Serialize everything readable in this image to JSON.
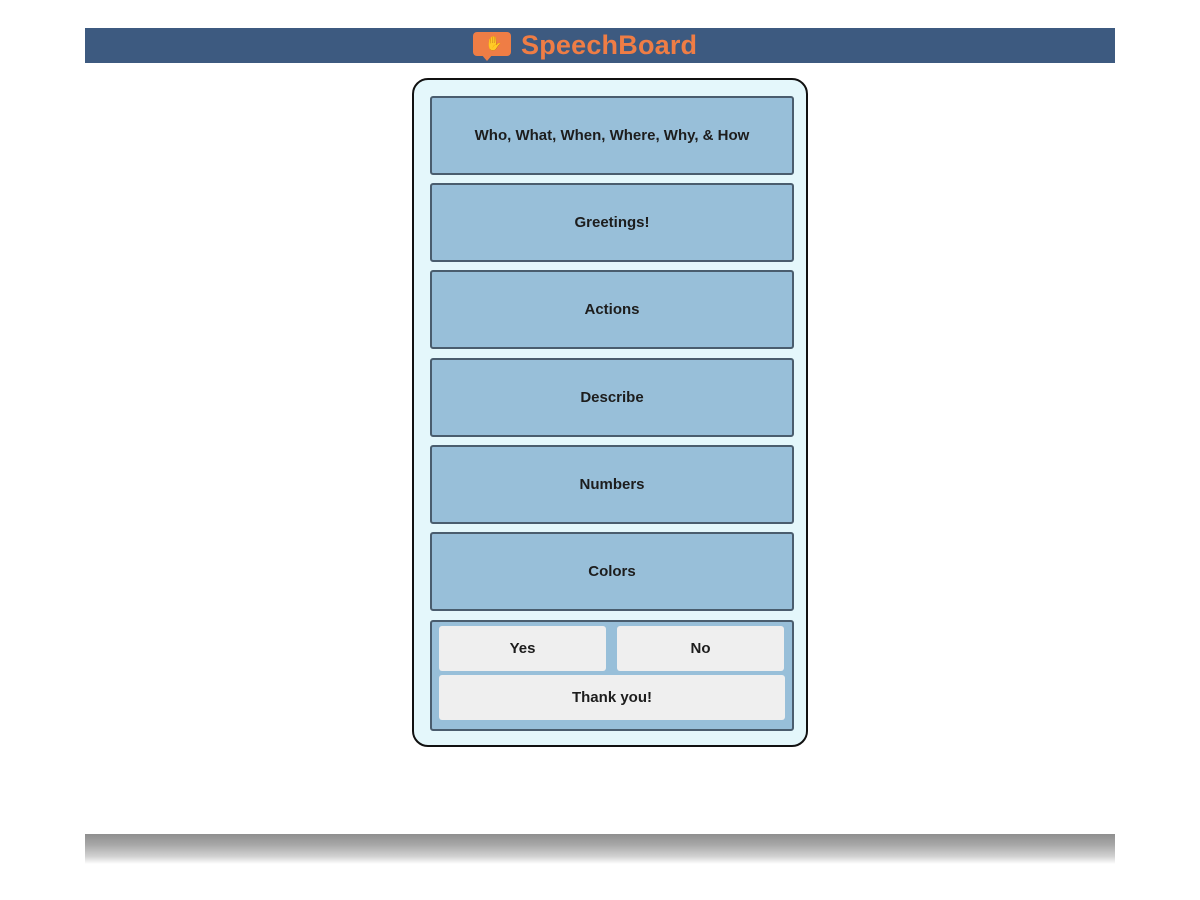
{
  "header": {
    "brand_name": "SpeechBoard",
    "logo_icon": "speech-bubble-hand-icon",
    "background_color": "#3d5a80",
    "brand_color": "#ef7d45"
  },
  "board": {
    "categories": [
      {
        "label": "Who, What, When, Where, Why, & How"
      },
      {
        "label": "Greetings!"
      },
      {
        "label": "Actions"
      },
      {
        "label": "Describe"
      },
      {
        "label": "Numbers"
      },
      {
        "label": "Colors"
      }
    ],
    "quick_phrases": {
      "yes_label": "Yes",
      "no_label": "No",
      "thank_you_label": "Thank you!"
    },
    "tile_color": "#98bfd9",
    "panel_color": "#e4f7fb"
  }
}
